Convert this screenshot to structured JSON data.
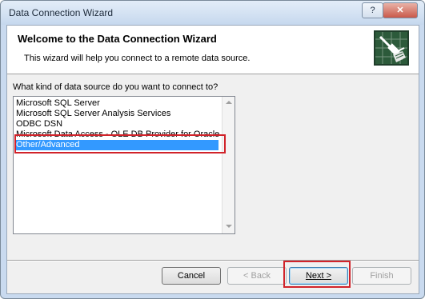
{
  "window": {
    "title": "Data Connection Wizard"
  },
  "titlebar_buttons": {
    "help": "?",
    "close": "✕"
  },
  "banner": {
    "title": "Welcome to the Data Connection Wizard",
    "subtitle": "This wizard will help you connect to a remote data source.",
    "icon": "connection-plug-icon"
  },
  "question": "What kind of data source do you want to connect to?",
  "data_sources": [
    "Microsoft SQL Server",
    "Microsoft SQL Server Analysis Services",
    "ODBC DSN",
    "Microsoft Data Access - OLE DB Provider for Oracle",
    "Other/Advanced"
  ],
  "selected_source": "Other/Advanced",
  "buttons": {
    "cancel": "Cancel",
    "back": "< Back",
    "next": "Next >",
    "finish": "Finish"
  },
  "colors": {
    "selection": "#3399ff",
    "highlight_box": "#d1232a"
  }
}
